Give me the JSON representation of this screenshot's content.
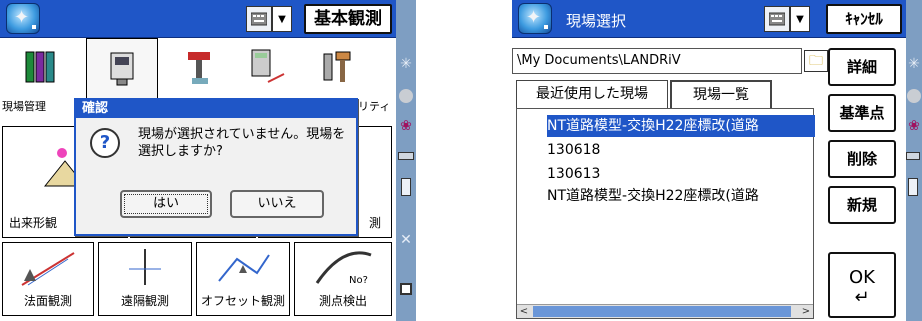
{
  "left": {
    "header": {
      "action_label": "基本観測"
    },
    "toolbar": [
      {
        "label": "現場管理"
      },
      {
        "label": ""
      },
      {
        "label": ""
      },
      {
        "label": ""
      },
      {
        "label": "リティ"
      }
    ],
    "tiles": [
      {
        "label": "出来形観"
      },
      {
        "label": ""
      },
      {
        "label": "測"
      },
      {
        "label": "法面観測"
      },
      {
        "label": "遠隔観測"
      },
      {
        "label": "オフセット観測"
      },
      {
        "label": "測点検出"
      }
    ],
    "dialog": {
      "title": "確認",
      "message": "現場が選択されていません。現場を選択しますか?",
      "yes_label": "はい",
      "no_label": "いいえ"
    }
  },
  "right": {
    "header": {
      "title": "現場選択",
      "action_label": "ｷｬﾝｾﾙ"
    },
    "path": "\\My Documents\\LANDRiV",
    "tabs": [
      {
        "label": "最近使用した現場"
      },
      {
        "label": "現場一覧"
      }
    ],
    "list": [
      "NT道路模型-交換H22座標改(道路",
      "130618",
      "130613",
      "NT道路模型-交換H22座標改(道路"
    ],
    "buttons": {
      "detail": "詳細",
      "reference": "基準点",
      "delete": "削除",
      "new": "新規",
      "ok": "OK"
    }
  },
  "colors": {
    "title_bar": "#1f56c7",
    "side_strip": "#7e9ec2",
    "selection": "#1f56c7"
  }
}
